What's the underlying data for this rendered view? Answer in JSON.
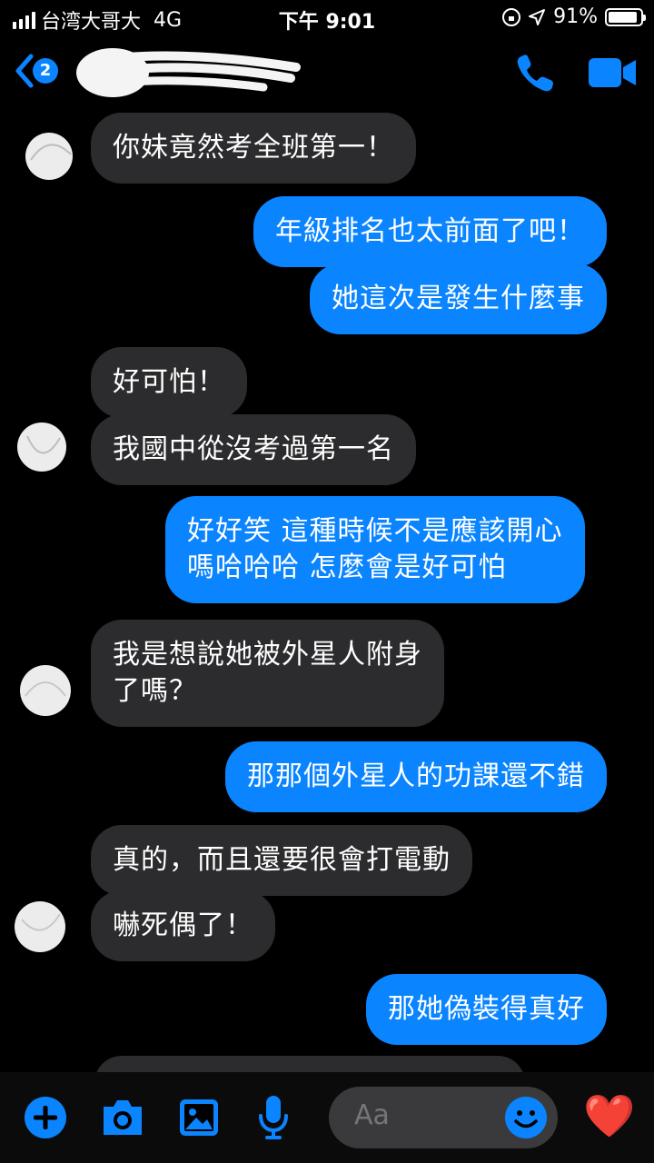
{
  "status_bar": {
    "carrier": "台湾大哥大",
    "network": "4G",
    "time": "下午 9:01",
    "battery": "91%",
    "battery_level": 0.91
  },
  "header": {
    "unread_count": "2"
  },
  "messages": [
    {
      "text": "你妹竟然考全班第一！"
    },
    {
      "text": "年級排名也太前面了吧！"
    },
    {
      "text": "她這次是發生什麼事"
    },
    {
      "text": "好可怕！"
    },
    {
      "text": "我國中從沒考過第一名"
    },
    {
      "line1": "好好笑 這種時候不是應該開心",
      "line2": "嗎哈哈哈 怎麼會是好可怕"
    },
    {
      "line1": "我是想說她被外星人附身",
      "line2": "了嗎？"
    },
    {
      "text": "那那個外星人的功課還不錯"
    },
    {
      "text": "真的，而且還要很會打電動"
    },
    {
      "text": "嚇死偶了！"
    },
    {
      "text": "那她偽裝得真好"
    }
  ],
  "composer": {
    "placeholder": "Aa",
    "reaction_emoji": "❤️"
  },
  "colors": {
    "outgoing": "#0a84ff",
    "incoming": "#2c2c2e",
    "accent": "#0a84ff"
  },
  "icons": [
    "signal-icon",
    "lock-rotation-icon",
    "location-arrow-icon",
    "battery-icon",
    "back-chevron-icon",
    "phone-icon",
    "video-camera-icon",
    "plus-icon",
    "camera-icon",
    "gallery-icon",
    "microphone-icon",
    "emoji-icon",
    "heart-icon"
  ]
}
